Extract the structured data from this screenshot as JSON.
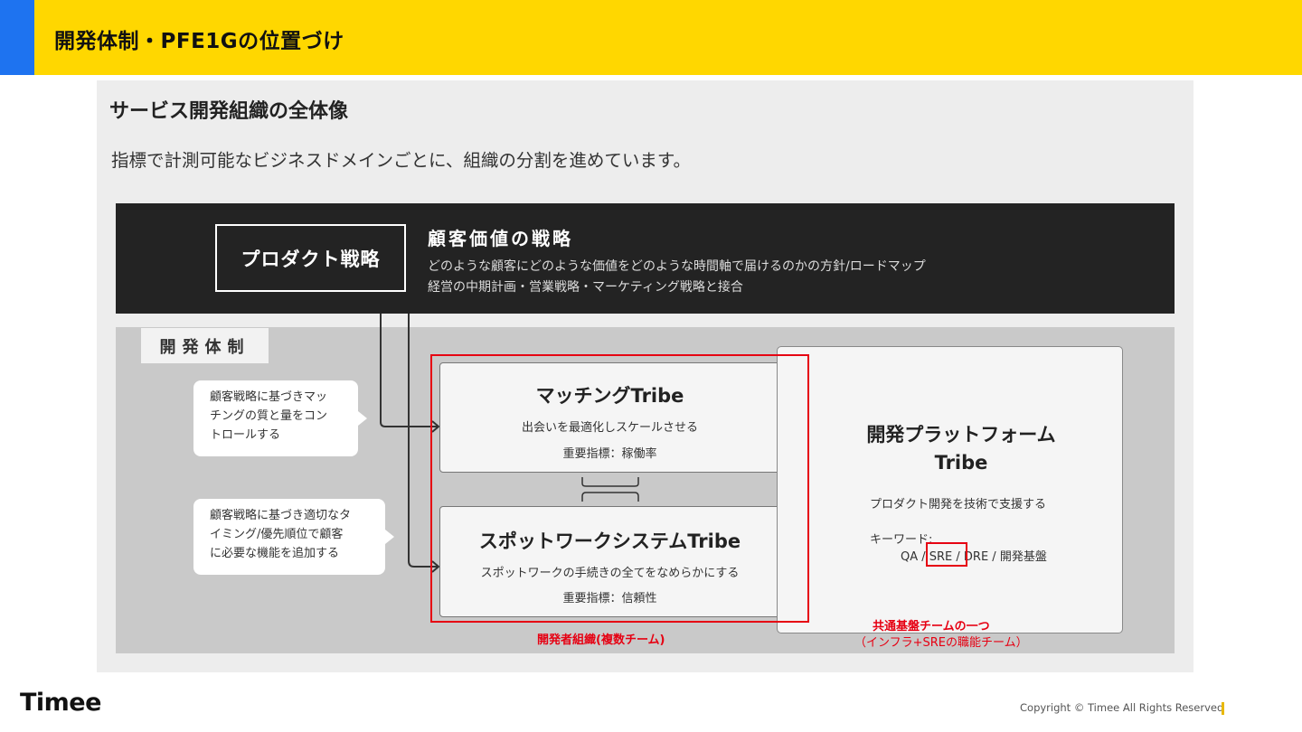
{
  "header": {
    "title": "開発体制・PFE1Gの位置づけ"
  },
  "section": {
    "title": "サービス開発組織の全体像",
    "subtitle": "指標で計測可能なビジネスドメインごとに、組織の分割を進めています。"
  },
  "strategy": {
    "box_label": "プロダクト戦略",
    "title": "顧客価値の戦略",
    "line1": "どのような顧客にどのような価値をどのような時間軸で届けるのかの方針/ロードマップ",
    "line2": "経営の中期計画・営業戦略・マーケティング戦略と接合"
  },
  "dev": {
    "label": "開発体制",
    "bubble1": [
      "顧客戦略に基づきマッ",
      "チングの質と量をコン",
      "トロールする"
    ],
    "bubble2": [
      "顧客戦略に基づき適切なタ",
      "イミング/優先順位で顧客",
      "に必要な機能を追加する"
    ],
    "matching": {
      "title": "マッチングTribe",
      "desc": "出会いを最適化しスケールさせる",
      "kpi": "重要指標：稼働率"
    },
    "spot": {
      "title": "スポットワークシステムTribe",
      "desc": "スポットワークの手続きの全てをなめらかにする",
      "kpi": "重要指標：信頼性"
    },
    "platform": {
      "title_line1": "開発プラットフォーム",
      "title_line2": "Tribe",
      "desc": "プロダクト開発を技術で支援する",
      "keyword_label": "キーワード:",
      "keywords": "QA / SRE / DRE / 開発基盤"
    },
    "org_label": "開発者組織(複数チーム)",
    "common_label": "共通基盤チームの一つ",
    "common_sub": "（インフラ+SREの職能チーム）"
  },
  "footer": {
    "logo": "Timee",
    "copyright": "Copyright © Timee All Rights Reserved"
  },
  "colors": {
    "header_bg": "#FFD700",
    "accent_blue": "#1E73F0",
    "highlight_red": "#E60012",
    "dark_band": "#232323"
  }
}
